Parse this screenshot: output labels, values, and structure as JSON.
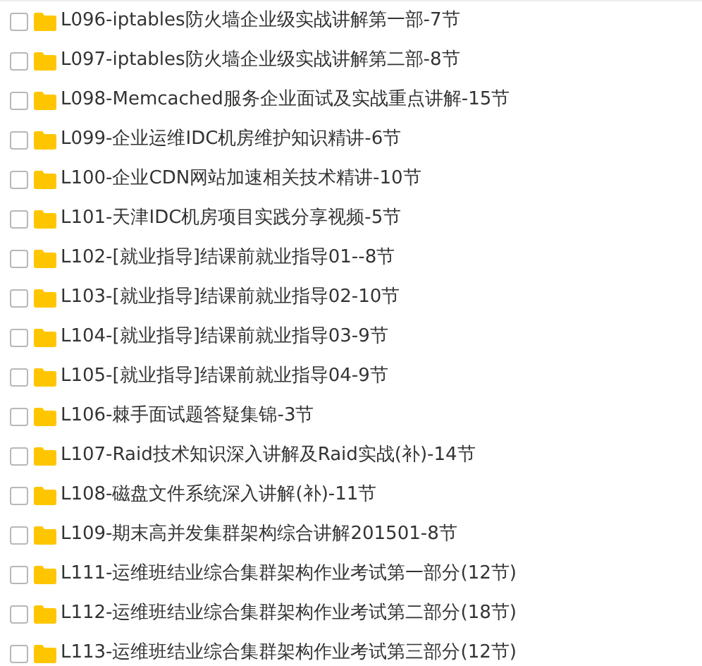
{
  "files": [
    {
      "name": "L096-iptables防火墙企业级实战讲解第一部-7节",
      "checked": false
    },
    {
      "name": "L097-iptables防火墙企业级实战讲解第二部-8节",
      "checked": false
    },
    {
      "name": "L098-Memcached服务企业面试及实战重点讲解-15节",
      "checked": false
    },
    {
      "name": "L099-企业运维IDC机房维护知识精讲-6节",
      "checked": false
    },
    {
      "name": "L100-企业CDN网站加速相关技术精讲-10节",
      "checked": false
    },
    {
      "name": "L101-天津IDC机房项目实践分享视频-5节",
      "checked": false
    },
    {
      "name": "L102-[就业指导]结课前就业指导01--8节",
      "checked": false
    },
    {
      "name": "L103-[就业指导]结课前就业指导02-10节",
      "checked": false
    },
    {
      "name": "L104-[就业指导]结课前就业指导03-9节",
      "checked": false
    },
    {
      "name": "L105-[就业指导]结课前就业指导04-9节",
      "checked": false
    },
    {
      "name": "L106-棘手面试题答疑集锦-3节",
      "checked": false
    },
    {
      "name": "L107-Raid技术知识深入讲解及Raid实战(补)-14节",
      "checked": false
    },
    {
      "name": "L108-磁盘文件系统深入讲解(补)-11节",
      "checked": false
    },
    {
      "name": "L109-期末高并发集群架构综合讲解201501-8节",
      "checked": false
    },
    {
      "name": "L111-运维班结业综合集群架构作业考试第一部分(12节)",
      "checked": false
    },
    {
      "name": "L112-运维班结业综合集群架构作业考试第二部分(18节)",
      "checked": false
    },
    {
      "name": "L113-运维班结业综合集群架构作业考试第三部分(12节)",
      "checked": false
    }
  ]
}
